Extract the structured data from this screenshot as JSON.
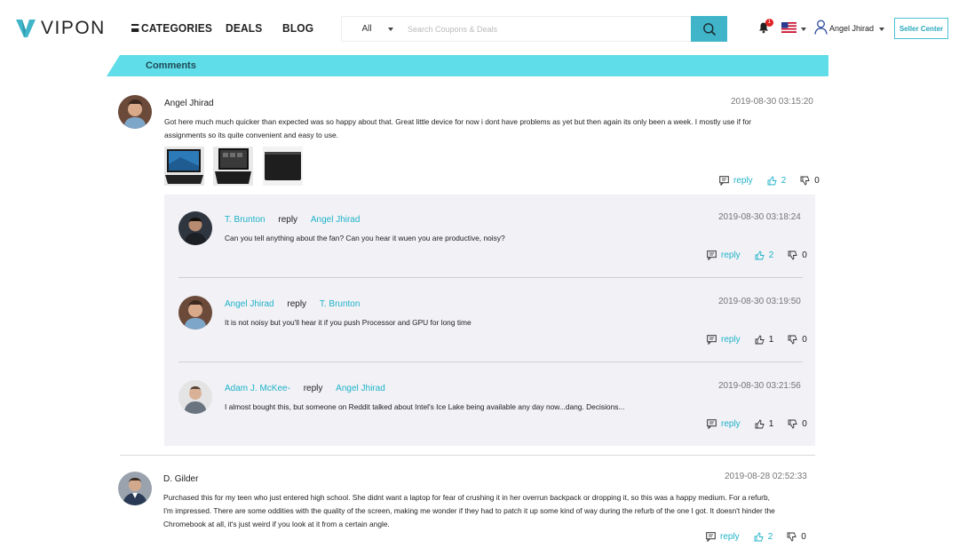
{
  "brand": {
    "name": "VIPON",
    "accent": "#40b5c9"
  },
  "nav": {
    "categories": "CATEGORIES",
    "deals": "DEALS",
    "blog": "BLOG"
  },
  "search": {
    "category": "All",
    "placeholder": "Search Coupons & Deals"
  },
  "header": {
    "notification_count": "1",
    "user_name": "Angel Jhirad",
    "seller_center": "Seller Center"
  },
  "section": {
    "title": "Comments"
  },
  "comments": [
    {
      "author": "Angel Jhirad",
      "date": "2019-08-30 03:15:20",
      "text_line1": "Got here much much quicker than expected was so happy about that. Great little device for now i dont have problems as yet but then again its only been a week. I mostly use if for",
      "text_line2": "assignments so its quite convenient and easy to use.",
      "reply_label": "reply",
      "likes": "2",
      "dislikes": "0"
    },
    {
      "author": "D. Gilder",
      "date": "2019-08-28 02:52:33",
      "text_line1": "Purchased this for my teen who just entered high school. She didnt want a laptop for fear of crushing it in her overrun backpack or dropping it, so this was a happy medium. For a refurb,",
      "text_line2": "I'm impressed. There are some oddities with the quality of the screen, making me wonder if they had to patch it up some kind of way during the refurb of the one I got. It doesn't hinder the",
      "text_line3": "Chromebook at all, it's just weird if you look at it from a certain angle.",
      "reply_label": "reply",
      "likes": "2",
      "dislikes": "0"
    }
  ],
  "replies": [
    {
      "author": "T. Brunton",
      "reply_word": "reply",
      "target": "Angel Jhirad",
      "date": "2019-08-30 03:18:24",
      "text": "Can you tell anything about the fan? Can you hear it wuen you are productive, noisy?",
      "reply_label": "reply",
      "likes": "2",
      "dislikes": "0"
    },
    {
      "author": "Angel Jhirad",
      "reply_word": "reply",
      "target": "T. Brunton",
      "date": "2019-08-30 03:19:50",
      "text": "It is not noisy but you'll hear it if you push Processor and GPU for long time",
      "reply_label": "reply",
      "likes": "1",
      "dislikes": "0"
    },
    {
      "author": "Adam J. McKee-",
      "reply_word": "reply",
      "target": "Angel Jhirad",
      "date": "2019-08-30 03:21:56",
      "text": "I almost bought this, but someone on Reddit talked about Intel's Ice Lake being available any day now...dang. Decisions...",
      "reply_label": "reply",
      "likes": "1",
      "dislikes": "0"
    }
  ]
}
